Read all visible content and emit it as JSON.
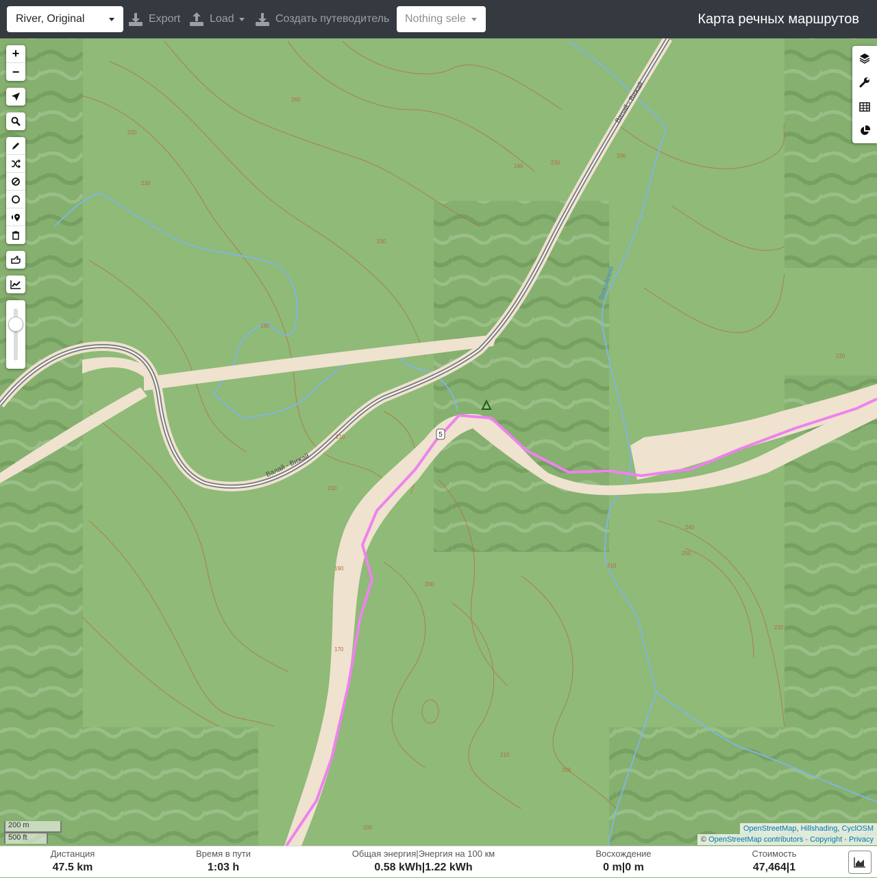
{
  "navbar": {
    "profile": "River, Original",
    "export_label": "Export",
    "load_label": "Load",
    "guide_label": "Создать путеводитель",
    "selection_placeholder": "Nothing selected",
    "selection_visible": "Nothing sele",
    "title": "Карта речных маршрутов"
  },
  "map": {
    "road_label_1": "Валай - Вижай",
    "road_label_2": "Валай - Вижай",
    "stream_label": "Вижайский",
    "route_marker": "5",
    "contours": [
      "260",
      "250",
      "240",
      "230",
      "220",
      "210",
      "200",
      "190",
      "180",
      "170"
    ],
    "colors": {
      "forest": "#8fba78",
      "hill": "#7aa566",
      "river_bank": "#efe2cf",
      "route": "#ee82ee",
      "stream": "#7fb6e6",
      "contour": "#b86a3c",
      "rail": "#777777"
    }
  },
  "left_toolbar": {
    "zoom_in": "+",
    "zoom_out": "−"
  },
  "scale": {
    "meters": "200 m",
    "feet": "500 ft"
  },
  "attribution": {
    "tiles": [
      "OpenStreetMap",
      "Hillshading",
      "CyclOSM"
    ],
    "copyright_prefix": "©",
    "osm_contributors": "OpenStreetMap contributors",
    "copyright_link": "Copyright",
    "privacy_link": "Privacy",
    "separator": "·"
  },
  "stats": {
    "distance_label": "Дистанция",
    "distance_value": "47.5",
    "distance_unit": "km",
    "time_label": "Время в пути",
    "time_value": "1:03",
    "time_unit": "h",
    "energy_label": "Общая энергия|Энергия на 100 км",
    "energy_value_1": "0.58",
    "energy_value_2": "1.22",
    "energy_unit": "kWh",
    "ascent_label": "Восхождение",
    "ascent_value_1": "0",
    "ascent_value_2": "0",
    "ascent_unit": "m",
    "cost_label": "Стоимость",
    "cost_value_1": "47,464",
    "cost_value_2": "1",
    "divider": "|"
  }
}
